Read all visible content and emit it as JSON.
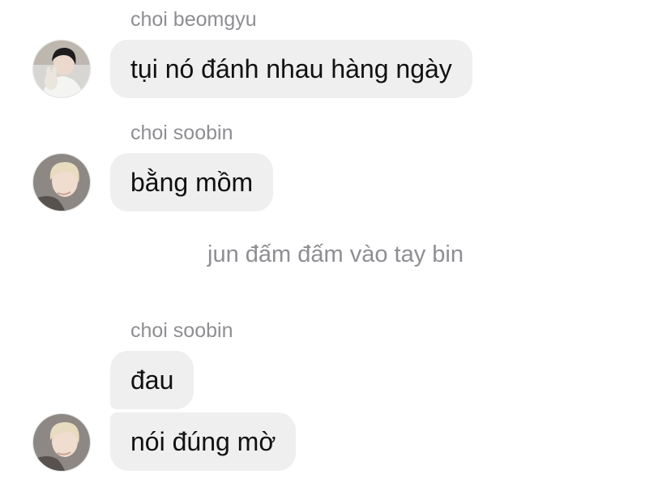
{
  "messages": [
    {
      "sender": "choi beomgyu",
      "text": "tụi nó đánh nhau hàng ngày",
      "avatar": "beomgyu-avatar-icon"
    },
    {
      "sender": "choi soobin",
      "text": "bằng mồm",
      "avatar": "soobin-avatar-icon"
    }
  ],
  "system_note": "jun đấm đấm vào tay bin",
  "group2": {
    "sender": "choi soobin",
    "messages": [
      "đau",
      "nói đúng mờ"
    ],
    "avatar": "soobin-avatar-icon"
  },
  "colors": {
    "bubble_bg": "#efefef",
    "sender_text": "#8e8e93",
    "message_text": "#111111",
    "background": "#ffffff"
  }
}
